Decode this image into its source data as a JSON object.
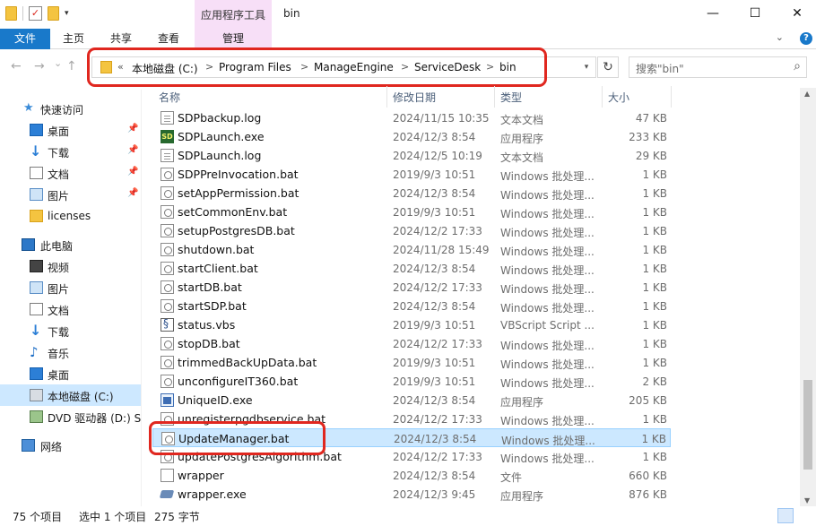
{
  "window": {
    "title": "bin",
    "contextual_tab_group": "应用程序工具",
    "controls": {
      "minimize": "—",
      "maximize": "☐",
      "close": "✕"
    }
  },
  "ribbon": {
    "tabs": [
      {
        "label": "文件"
      },
      {
        "label": "主页"
      },
      {
        "label": "共享"
      },
      {
        "label": "查看"
      },
      {
        "label": "管理"
      }
    ],
    "expand_icon": "chevron-down-icon",
    "help_icon": "?"
  },
  "address": {
    "overflow": "«",
    "separator": ">",
    "segments": [
      "本地磁盘 (C:)",
      "Program Files",
      "ManageEngine",
      "ServiceDesk",
      "bin"
    ],
    "refresh": "↻"
  },
  "search": {
    "placeholder": "搜索\"bin\"",
    "icon": "⌕"
  },
  "nav_buttons": {
    "back": "←",
    "forward": "→",
    "recent": "⌄",
    "up": "↑"
  },
  "nav_pane": {
    "items": [
      {
        "label": "快速访问",
        "icon": "star-icon",
        "pinned": false
      },
      {
        "label": "桌面",
        "icon": "desktop-icon",
        "pinned": true
      },
      {
        "label": "下载",
        "icon": "download-icon",
        "pinned": true
      },
      {
        "label": "文档",
        "icon": "document-icon",
        "pinned": true
      },
      {
        "label": "图片",
        "icon": "pictures-icon",
        "pinned": true
      },
      {
        "label": "licenses",
        "icon": "folder-icon",
        "pinned": false
      },
      {
        "label": "此电脑",
        "icon": "pc-icon",
        "pinned": false
      },
      {
        "label": "视频",
        "icon": "video-icon",
        "pinned": false
      },
      {
        "label": "图片",
        "icon": "pictures-icon",
        "pinned": false
      },
      {
        "label": "文档",
        "icon": "document-icon",
        "pinned": false
      },
      {
        "label": "下载",
        "icon": "download-icon",
        "pinned": false
      },
      {
        "label": "音乐",
        "icon": "music-icon",
        "pinned": false
      },
      {
        "label": "桌面",
        "icon": "desktop-icon",
        "pinned": false
      },
      {
        "label": "本地磁盘 (C:)",
        "icon": "drive-icon",
        "pinned": false,
        "selected": true
      },
      {
        "label": "DVD 驱动器 (D:) SS",
        "icon": "dvd-icon",
        "pinned": false
      },
      {
        "label": "网络",
        "icon": "network-icon",
        "pinned": false
      }
    ],
    "pin_glyph": "📌"
  },
  "columns": {
    "name": "名称",
    "modified": "修改日期",
    "type": "类型",
    "size": "大小"
  },
  "files": [
    {
      "name": "SDPbackup.log",
      "date": "2024/11/15 10:35",
      "type": "文本文档",
      "size": "47 KB",
      "icon": "txt"
    },
    {
      "name": "SDPLaunch.exe",
      "date": "2024/12/3 8:54",
      "type": "应用程序",
      "size": "233 KB",
      "icon": "sdp"
    },
    {
      "name": "SDPLaunch.log",
      "date": "2024/12/5 10:19",
      "type": "文本文档",
      "size": "29 KB",
      "icon": "txt"
    },
    {
      "name": "SDPPreInvocation.bat",
      "date": "2019/9/3 10:51",
      "type": "Windows 批处理...",
      "size": "1 KB",
      "icon": "bat"
    },
    {
      "name": "setAppPermission.bat",
      "date": "2024/12/3 8:54",
      "type": "Windows 批处理...",
      "size": "1 KB",
      "icon": "bat"
    },
    {
      "name": "setCommonEnv.bat",
      "date": "2019/9/3 10:51",
      "type": "Windows 批处理...",
      "size": "1 KB",
      "icon": "bat"
    },
    {
      "name": "setupPostgresDB.bat",
      "date": "2024/12/2 17:33",
      "type": "Windows 批处理...",
      "size": "1 KB",
      "icon": "bat"
    },
    {
      "name": "shutdown.bat",
      "date": "2024/11/28 15:49",
      "type": "Windows 批处理...",
      "size": "1 KB",
      "icon": "bat"
    },
    {
      "name": "startClient.bat",
      "date": "2024/12/3 8:54",
      "type": "Windows 批处理...",
      "size": "1 KB",
      "icon": "bat"
    },
    {
      "name": "startDB.bat",
      "date": "2024/12/2 17:33",
      "type": "Windows 批处理...",
      "size": "1 KB",
      "icon": "bat"
    },
    {
      "name": "startSDP.bat",
      "date": "2024/12/3 8:54",
      "type": "Windows 批处理...",
      "size": "1 KB",
      "icon": "bat"
    },
    {
      "name": "status.vbs",
      "date": "2019/9/3 10:51",
      "type": "VBScript Script ...",
      "size": "1 KB",
      "icon": "vbs"
    },
    {
      "name": "stopDB.bat",
      "date": "2024/12/2 17:33",
      "type": "Windows 批处理...",
      "size": "1 KB",
      "icon": "bat"
    },
    {
      "name": "trimmedBackUpData.bat",
      "date": "2019/9/3 10:51",
      "type": "Windows 批处理...",
      "size": "1 KB",
      "icon": "bat"
    },
    {
      "name": "unconfigureIT360.bat",
      "date": "2019/9/3 10:51",
      "type": "Windows 批处理...",
      "size": "2 KB",
      "icon": "bat"
    },
    {
      "name": "UniqueID.exe",
      "date": "2024/12/3 8:54",
      "type": "应用程序",
      "size": "205 KB",
      "icon": "uid"
    },
    {
      "name": "unregisterpgdbservice.bat",
      "date": "2024/12/2 17:33",
      "type": "Windows 批处理...",
      "size": "1 KB",
      "icon": "bat"
    },
    {
      "name": "UpdateManager.bat",
      "date": "2024/12/3 8:54",
      "type": "Windows 批处理...",
      "size": "1 KB",
      "icon": "bat",
      "selected": true
    },
    {
      "name": "updatePostgresAlgorithm.bat",
      "date": "2024/12/2 17:33",
      "type": "Windows 批处理...",
      "size": "1 KB",
      "icon": "bat"
    },
    {
      "name": "wrapper",
      "date": "2024/12/3 8:54",
      "type": "文件",
      "size": "660 KB",
      "icon": "file"
    },
    {
      "name": "wrapper.exe",
      "date": "2024/12/3 9:45",
      "type": "应用程序",
      "size": "876 KB",
      "icon": "wexe"
    }
  ],
  "status": {
    "count": "75 个项目",
    "selection": "选中 1 个项目",
    "size": "275 字节"
  }
}
